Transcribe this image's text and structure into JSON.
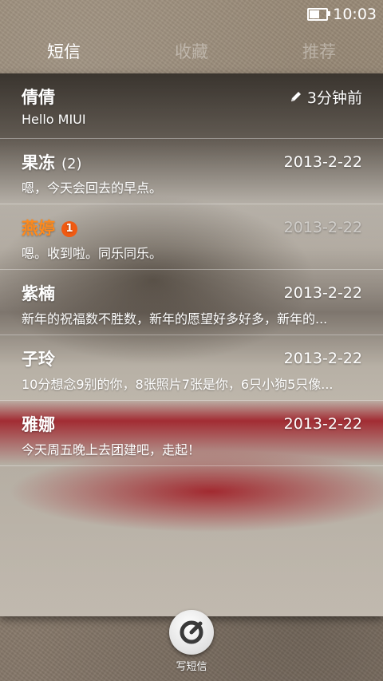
{
  "status": {
    "time": "10:03"
  },
  "tabs": [
    {
      "label": "短信",
      "active": true
    },
    {
      "label": "收藏",
      "active": false
    },
    {
      "label": "推荐",
      "active": false
    }
  ],
  "messages": [
    {
      "name": "倩倩",
      "count": "",
      "badge": "",
      "date": "3分钟前",
      "preview": "Hello MIUI",
      "draft": true,
      "unread": false
    },
    {
      "name": "果冻",
      "count": "(2)",
      "badge": "",
      "date": "2013-2-22",
      "preview": "嗯，今天会回去的早点。",
      "draft": false,
      "unread": false
    },
    {
      "name": "燕婷",
      "count": "",
      "badge": "1",
      "date": "2013-2-22",
      "preview": "嗯。收到啦。同乐同乐。",
      "draft": false,
      "unread": true
    },
    {
      "name": "紫楠",
      "count": "",
      "badge": "",
      "date": "2013-2-22",
      "preview": "新年的祝福数不胜数，新年的愿望好多好多，新年的...",
      "draft": false,
      "unread": false
    },
    {
      "name": "子玲",
      "count": "",
      "badge": "",
      "date": "2013-2-22",
      "preview": "10分想念9别的你，8张照片7张是你，6只小狗5只像...",
      "draft": false,
      "unread": false
    },
    {
      "name": "雅娜",
      "count": "",
      "badge": "",
      "date": "2013-2-22",
      "preview": "今天周五晚上去团建吧，走起！",
      "draft": false,
      "unread": false
    }
  ],
  "compose": {
    "label": "写短信",
    "icon": "compose-icon"
  },
  "colors": {
    "accent_unread": "#ff8a1c",
    "badge": "#f05a12"
  }
}
